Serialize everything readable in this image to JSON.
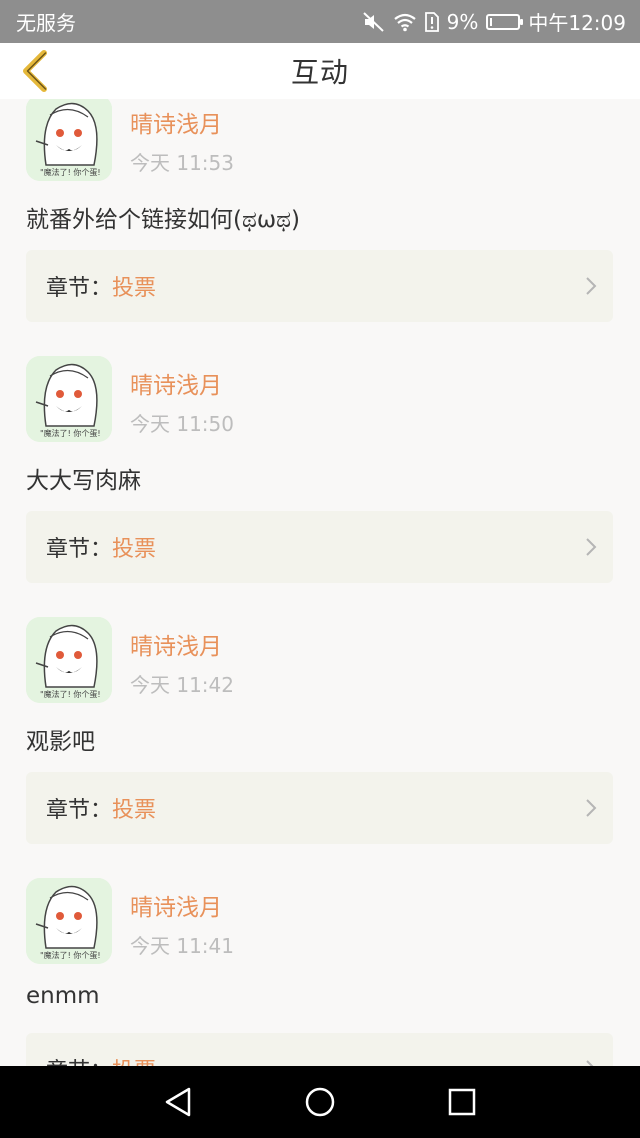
{
  "status_bar": {
    "carrier": "无服务",
    "battery_percent": "9%",
    "battery_level": 0.09,
    "time": "中午12:09",
    "icons": [
      "mute-icon",
      "wifi-icon",
      "sim-alert-icon",
      "battery-icon"
    ]
  },
  "header": {
    "title": "互动",
    "back_icon": "chevron-left-icon"
  },
  "comments": [
    {
      "username": "晴诗浅月",
      "time": "今天 11:53",
      "content": "就番外给个链接如何(ಥωಥ)",
      "chapter_label": "章节：",
      "chapter_name": "投票"
    },
    {
      "username": "晴诗浅月",
      "time": "今天 11:50",
      "content": "大大写肉麻",
      "chapter_label": "章节：",
      "chapter_name": "投票"
    },
    {
      "username": "晴诗浅月",
      "time": "今天 11:42",
      "content": "观影吧",
      "chapter_label": "章节：",
      "chapter_name": "投票"
    },
    {
      "username": "晴诗浅月",
      "time": "今天 11:41",
      "content": "enmm",
      "chapter_label": "章节：",
      "chapter_name": "投票"
    }
  ],
  "nav_bar": {
    "icons": [
      "back-triangle-icon",
      "home-circle-icon",
      "recents-square-icon"
    ]
  },
  "colors": {
    "accent": "#e8915a",
    "status_bar_bg": "#8e8e8e",
    "chapter_bg": "#f3f3ec",
    "back_icon": "#e5b83a"
  }
}
